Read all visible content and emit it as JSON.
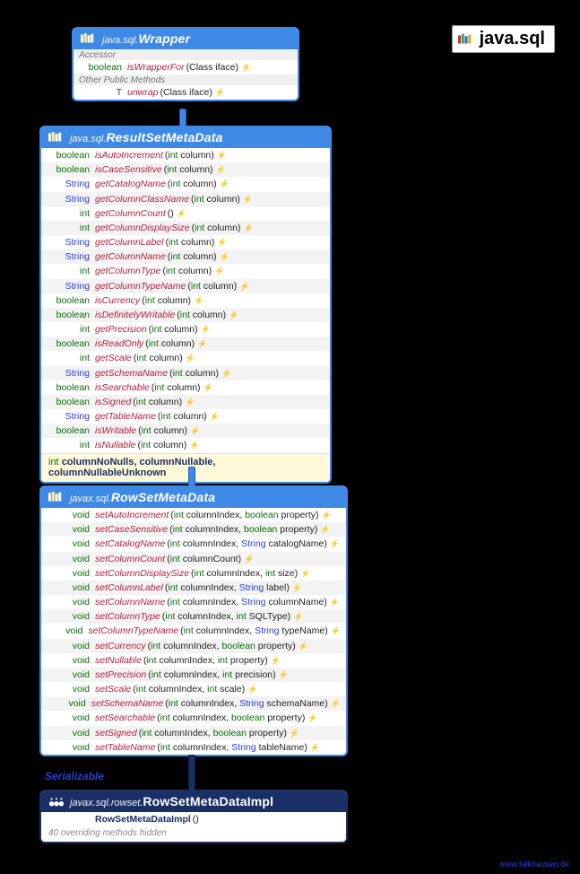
{
  "packageLabel": "java.sql",
  "footer": "www.falkhausen.de",
  "serializableLabel": "Serializable",
  "wrapper": {
    "pkg": "java.sql.",
    "cls": "Wrapper",
    "section1": "Accessor",
    "section2": "Other Public Methods",
    "rows": [
      {
        "ret": "boolean",
        "retClass": "kw",
        "name": "isWrapperFor",
        "params": "(Class<?> iface)",
        "exc": "⚡"
      },
      {
        "ret": "<T> T",
        "retClass": "",
        "name": "unwrap",
        "params": "(Class<T> iface)",
        "exc": "⚡"
      }
    ]
  },
  "rsmd": {
    "pkg": "java.sql.",
    "cls": "ResultSetMetaData",
    "rows": [
      {
        "ret": "boolean",
        "rc": "kw",
        "name": "isAutoIncrement",
        "p": "(§int§ column)"
      },
      {
        "ret": "boolean",
        "rc": "kw",
        "name": "isCaseSensitive",
        "p": "(§int§ column)"
      },
      {
        "ret": "String",
        "rc": "ref",
        "name": "getCatalogName",
        "p": "(§int§ column)"
      },
      {
        "ret": "String",
        "rc": "ref",
        "name": "getColumnClassName",
        "p": "(§int§ column)"
      },
      {
        "ret": "int",
        "rc": "kw",
        "name": "getColumnCount",
        "p": "()"
      },
      {
        "ret": "int",
        "rc": "kw",
        "name": "getColumnDisplaySize",
        "p": "(§int§ column)"
      },
      {
        "ret": "String",
        "rc": "ref",
        "name": "getColumnLabel",
        "p": "(§int§ column)"
      },
      {
        "ret": "String",
        "rc": "ref",
        "name": "getColumnName",
        "p": "(§int§ column)"
      },
      {
        "ret": "int",
        "rc": "kw",
        "name": "getColumnType",
        "p": "(§int§ column)"
      },
      {
        "ret": "String",
        "rc": "ref",
        "name": "getColumnTypeName",
        "p": "(§int§ column)"
      },
      {
        "ret": "boolean",
        "rc": "kw",
        "name": "isCurrency",
        "p": "(§int§ column)"
      },
      {
        "ret": "boolean",
        "rc": "kw",
        "name": "isDefinitelyWritable",
        "p": "(§int§ column)"
      },
      {
        "ret": "int",
        "rc": "kw",
        "name": "getPrecision",
        "p": "(§int§ column)"
      },
      {
        "ret": "boolean",
        "rc": "kw",
        "name": "isReadOnly",
        "p": "(§int§ column)"
      },
      {
        "ret": "int",
        "rc": "kw",
        "name": "getScale",
        "p": "(§int§ column)"
      },
      {
        "ret": "String",
        "rc": "ref",
        "name": "getSchemaName",
        "p": "(§int§ column)"
      },
      {
        "ret": "boolean",
        "rc": "kw",
        "name": "isSearchable",
        "p": "(§int§ column)"
      },
      {
        "ret": "boolean",
        "rc": "kw",
        "name": "isSigned",
        "p": "(§int§ column)"
      },
      {
        "ret": "String",
        "rc": "ref",
        "name": "getTableName",
        "p": "(§int§ column)"
      },
      {
        "ret": "boolean",
        "rc": "kw",
        "name": "isWritable",
        "p": "(§int§ column)"
      },
      {
        "ret": "int",
        "rc": "kw",
        "name": "isNullable",
        "p": "(§int§ column)"
      }
    ],
    "fieldsType": "int",
    "fields": "columnNoNulls, columnNullable, columnNullableUnknown"
  },
  "rowset": {
    "pkg": "javax.sql.",
    "cls": "RowSetMetaData",
    "rows": [
      {
        "ret": "void",
        "name": "setAutoIncrement",
        "p": "(§int§ columnIndex, §boolean§ property)"
      },
      {
        "ret": "void",
        "name": "setCaseSensitive",
        "p": "(§int§ columnIndex, §boolean§ property)"
      },
      {
        "ret": "void",
        "name": "setCatalogName",
        "p": "(§int§ columnIndex, ¶String¶ catalogName)"
      },
      {
        "ret": "void",
        "name": "setColumnCount",
        "p": "(§int§ columnCount)"
      },
      {
        "ret": "void",
        "name": "setColumnDisplaySize",
        "p": "(§int§ columnIndex, §int§ size)"
      },
      {
        "ret": "void",
        "name": "setColumnLabel",
        "p": "(§int§ columnIndex, ¶String¶ label)"
      },
      {
        "ret": "void",
        "name": "setColumnName",
        "p": "(§int§ columnIndex, ¶String¶ columnName)"
      },
      {
        "ret": "void",
        "name": "setColumnType",
        "p": "(§int§ columnIndex, §int§ SQLType)"
      },
      {
        "ret": "void",
        "name": "setColumnTypeName",
        "p": "(§int§ columnIndex, ¶String¶ typeName)"
      },
      {
        "ret": "void",
        "name": "setCurrency",
        "p": "(§int§ columnIndex, §boolean§ property)"
      },
      {
        "ret": "void",
        "name": "setNullable",
        "p": "(§int§ columnIndex, §int§ property)"
      },
      {
        "ret": "void",
        "name": "setPrecision",
        "p": "(§int§ columnIndex, §int§ precision)"
      },
      {
        "ret": "void",
        "name": "setScale",
        "p": "(§int§ columnIndex, §int§ scale)"
      },
      {
        "ret": "void",
        "name": "setSchemaName",
        "p": "(§int§ columnIndex, ¶String¶ schemaName)"
      },
      {
        "ret": "void",
        "name": "setSearchable",
        "p": "(§int§ columnIndex, §boolean§ property)"
      },
      {
        "ret": "void",
        "name": "setSigned",
        "p": "(§int§ columnIndex, §boolean§ property)"
      },
      {
        "ret": "void",
        "name": "setTableName",
        "p": "(§int§ columnIndex, ¶String¶ tableName)"
      }
    ]
  },
  "impl": {
    "pkg": "javax.sql.rowset.",
    "cls": "RowSetMetaDataImpl",
    "ctor": "RowSetMetaDataImpl",
    "ctorParams": "()",
    "hidden": "40 overriding methods hidden"
  }
}
